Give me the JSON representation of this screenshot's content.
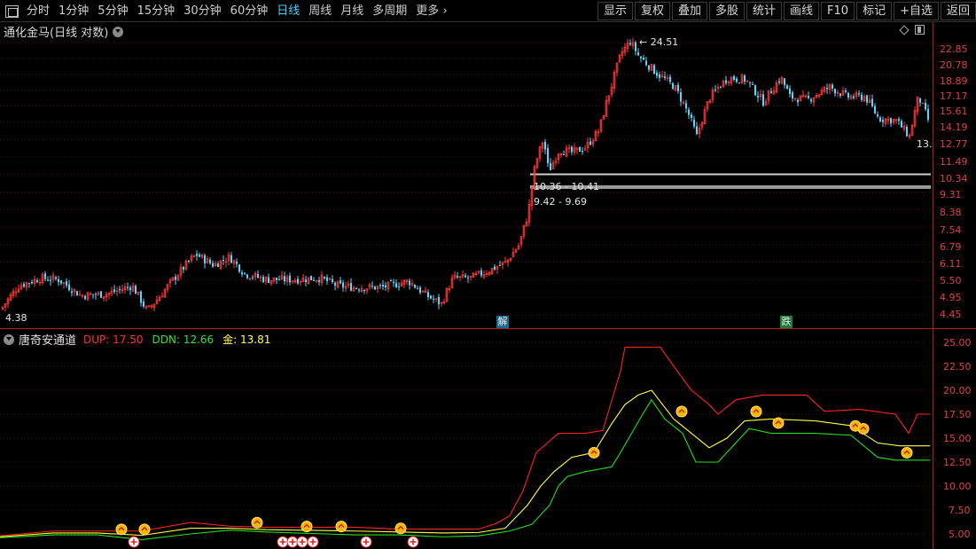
{
  "toolbar": {
    "periods": [
      "分时",
      "1分钟",
      "5分钟",
      "15分钟",
      "30分钟",
      "60分钟",
      "日线",
      "周线",
      "月线",
      "多周期",
      "更多"
    ],
    "active_period": "日线",
    "more_arrow": "›",
    "actions": [
      "显示",
      "复权",
      "叠加",
      "多股",
      "统计",
      "画线",
      "F10",
      "标记",
      "+自选",
      "返回"
    ]
  },
  "main_pane": {
    "title": "通化金马(日线 对数)",
    "price_axis": [
      "22.85",
      "20.78",
      "18.89",
      "17.17",
      "15.61",
      "14.19",
      "12.77",
      "11.49",
      "10.34",
      "9.31",
      "8.38",
      "7.54",
      "6.79",
      "6.11",
      "5.50",
      "4.95",
      "4.45"
    ],
    "high_label": "24.51",
    "low_label": "4.38",
    "last_label": "13.",
    "zone_upper": "10.36 - 10.41",
    "zone_lower": "9.42 - 9.69",
    "events": [
      {
        "text": "解",
        "type": "jie"
      },
      {
        "text": "跌",
        "type": "die"
      }
    ]
  },
  "sub_pane": {
    "name": "唐奇安通道",
    "dup_label": "DUP: 17.50",
    "ddn_label": "DDN: 12.66",
    "gold_label": "金: 13.81",
    "axis": [
      "25.00",
      "22.50",
      "20.00",
      "17.50",
      "15.00",
      "12.50",
      "10.00",
      "7.50",
      "5.00"
    ],
    "colors": {
      "dup": "#ff2020",
      "ddn": "#20e020",
      "mid": "#ffff40",
      "axis": "#e04040"
    }
  },
  "chart_data": [
    {
      "type": "candlestick",
      "title": "通化金马(日线 对数)",
      "scale": "log",
      "ylim": [
        4.3,
        25.5
      ],
      "y_ticks": [
        22.85,
        20.78,
        18.89,
        17.17,
        15.61,
        14.19,
        12.77,
        11.49,
        10.34,
        9.31,
        8.38,
        7.54,
        6.79,
        6.11,
        5.5,
        4.95,
        4.45
      ],
      "close_path": [
        [
          0,
          4.6
        ],
        [
          20,
          5.3
        ],
        [
          45,
          5.55
        ],
        [
          65,
          5.5
        ],
        [
          90,
          5.0
        ],
        [
          120,
          5.05
        ],
        [
          148,
          5.3
        ],
        [
          165,
          4.55
        ],
        [
          180,
          5.0
        ],
        [
          200,
          5.7
        ],
        [
          220,
          6.4
        ],
        [
          240,
          6.0
        ],
        [
          258,
          6.3
        ],
        [
          275,
          5.7
        ],
        [
          300,
          5.5
        ],
        [
          330,
          5.5
        ],
        [
          360,
          5.55
        ],
        [
          380,
          5.3
        ],
        [
          400,
          5.25
        ],
        [
          430,
          5.25
        ],
        [
          460,
          5.45
        ],
        [
          480,
          5.0
        ],
        [
          497,
          4.75
        ],
        [
          510,
          5.55
        ],
        [
          530,
          5.55
        ],
        [
          550,
          5.8
        ],
        [
          570,
          6.1
        ],
        [
          585,
          6.8
        ],
        [
          595,
          8.2
        ],
        [
          603,
          11.0
        ],
        [
          612,
          12.8
        ],
        [
          618,
          10.5
        ],
        [
          630,
          12.0
        ],
        [
          645,
          11.8
        ],
        [
          660,
          12.2
        ],
        [
          675,
          13.5
        ],
        [
          690,
          18.0
        ],
        [
          700,
          21.5
        ],
        [
          710,
          23.0
        ],
        [
          720,
          21.0
        ],
        [
          740,
          19.0
        ],
        [
          760,
          17.5
        ],
        [
          775,
          15.0
        ],
        [
          785,
          13.0
        ],
        [
          800,
          16.5
        ],
        [
          820,
          18.5
        ],
        [
          840,
          18.3
        ],
        [
          860,
          16.0
        ],
        [
          880,
          18.5
        ],
        [
          890,
          16.5
        ],
        [
          910,
          16.2
        ],
        [
          935,
          17.5
        ],
        [
          955,
          16.5
        ],
        [
          975,
          16.5
        ],
        [
          990,
          14.5
        ],
        [
          1010,
          14.3
        ],
        [
          1025,
          13.0
        ],
        [
          1035,
          16.5
        ],
        [
          1048,
          14.0
        ]
      ],
      "high": 24.51,
      "low": 4.38,
      "annotations": [
        "24.51",
        "4.38",
        "10.36 - 10.41",
        "9.42 - 9.69"
      ]
    },
    {
      "type": "line",
      "title": "唐奇安通道",
      "ylim": [
        4.2,
        26.0
      ],
      "y_ticks": [
        25.0,
        22.5,
        20.0,
        17.5,
        15.0,
        12.5,
        10.0,
        7.5,
        5.0
      ],
      "series": [
        {
          "name": "DUP",
          "color": "#ff2020",
          "points": [
            [
              0,
              4.8
            ],
            [
              60,
              5.3
            ],
            [
              110,
              5.3
            ],
            [
              160,
              5.3
            ],
            [
              215,
              6.2
            ],
            [
              260,
              5.8
            ],
            [
              300,
              5.7
            ],
            [
              400,
              5.7
            ],
            [
              450,
              5.5
            ],
            [
              500,
              5.5
            ],
            [
              540,
              5.5
            ],
            [
              560,
              6.1
            ],
            [
              575,
              6.9
            ],
            [
              590,
              9.5
            ],
            [
              605,
              13.5
            ],
            [
              630,
              15.5
            ],
            [
              660,
              15.5
            ],
            [
              680,
              15.8
            ],
            [
              700,
              22.0
            ],
            [
              705,
              24.5
            ],
            [
              745,
              24.5
            ],
            [
              760,
              22.5
            ],
            [
              780,
              20.0
            ],
            [
              800,
              18.5
            ],
            [
              810,
              17.5
            ],
            [
              830,
              19.0
            ],
            [
              860,
              19.5
            ],
            [
              910,
              19.5
            ],
            [
              930,
              17.8
            ],
            [
              970,
              18.0
            ],
            [
              1010,
              17.5
            ],
            [
              1025,
              15.5
            ],
            [
              1035,
              17.5
            ],
            [
              1049,
              17.5
            ]
          ]
        },
        {
          "name": "DDN",
          "color": "#20e020",
          "points": [
            [
              0,
              4.6
            ],
            [
              60,
              4.9
            ],
            [
              110,
              4.9
            ],
            [
              160,
              4.4
            ],
            [
              215,
              5.0
            ],
            [
              260,
              5.4
            ],
            [
              300,
              5.2
            ],
            [
              400,
              4.9
            ],
            [
              450,
              4.9
            ],
            [
              500,
              4.7
            ],
            [
              540,
              4.8
            ],
            [
              575,
              5.3
            ],
            [
              600,
              6.0
            ],
            [
              620,
              8.0
            ],
            [
              630,
              10.0
            ],
            [
              640,
              11.0
            ],
            [
              660,
              11.5
            ],
            [
              690,
              12.0
            ],
            [
              700,
              13.5
            ],
            [
              725,
              17.5
            ],
            [
              735,
              19.0
            ],
            [
              750,
              17.0
            ],
            [
              770,
              15.5
            ],
            [
              785,
              12.5
            ],
            [
              810,
              12.5
            ],
            [
              830,
              14.5
            ],
            [
              845,
              16.0
            ],
            [
              870,
              15.5
            ],
            [
              920,
              15.5
            ],
            [
              960,
              15.3
            ],
            [
              990,
              13.0
            ],
            [
              1010,
              12.7
            ],
            [
              1049,
              12.7
            ]
          ]
        },
        {
          "name": "金",
          "color": "#ffff40",
          "points": [
            [
              0,
              4.7
            ],
            [
              60,
              5.1
            ],
            [
              110,
              5.1
            ],
            [
              160,
              4.85
            ],
            [
              215,
              5.6
            ],
            [
              260,
              5.6
            ],
            [
              300,
              5.45
            ],
            [
              400,
              5.3
            ],
            [
              450,
              5.2
            ],
            [
              500,
              5.1
            ],
            [
              540,
              5.15
            ],
            [
              570,
              5.6
            ],
            [
              595,
              8.0
            ],
            [
              610,
              10.0
            ],
            [
              625,
              11.5
            ],
            [
              645,
              13.0
            ],
            [
              670,
              13.5
            ],
            [
              690,
              16.5
            ],
            [
              705,
              18.5
            ],
            [
              720,
              19.5
            ],
            [
              735,
              20.0
            ],
            [
              760,
              17.0
            ],
            [
              780,
              15.5
            ],
            [
              800,
              14.0
            ],
            [
              820,
              15.0
            ],
            [
              840,
              16.8
            ],
            [
              870,
              17.0
            ],
            [
              920,
              16.8
            ],
            [
              960,
              16.3
            ],
            [
              990,
              14.5
            ],
            [
              1015,
              14.2
            ],
            [
              1049,
              14.2
            ]
          ]
        }
      ]
    }
  ]
}
